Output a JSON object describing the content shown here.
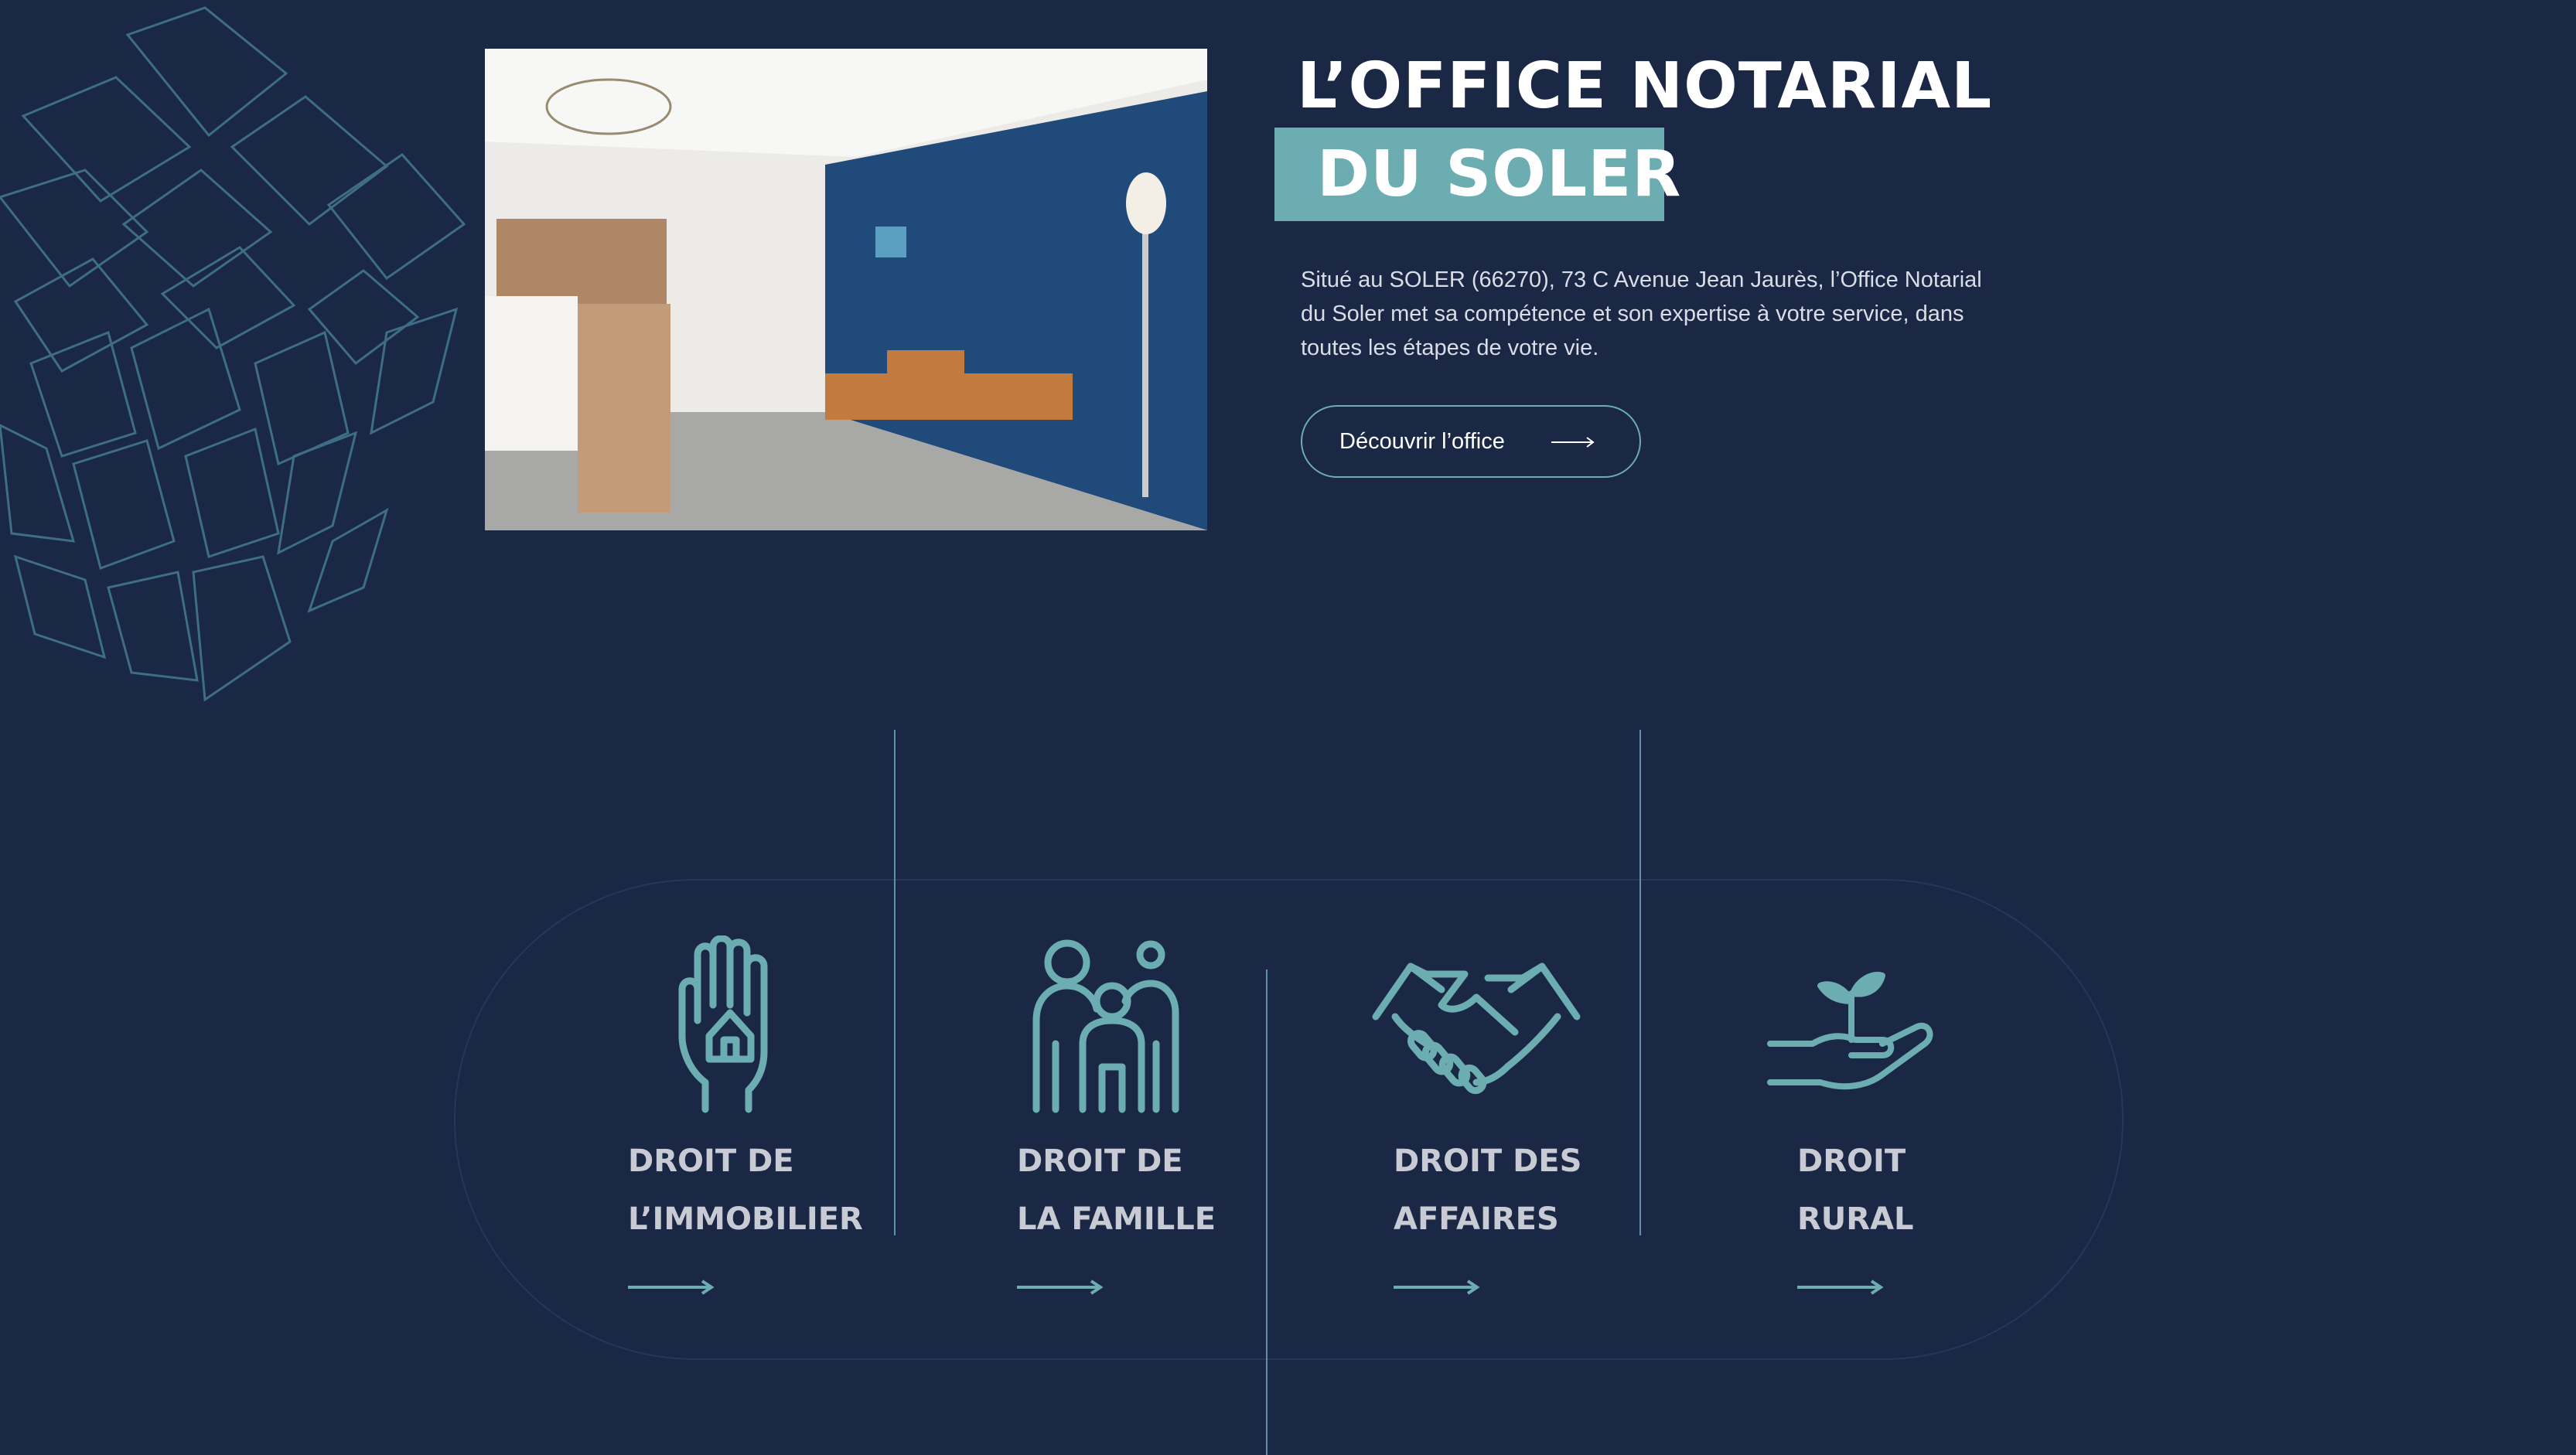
{
  "hero": {
    "title_line1": "L’OFFICE NOTARIAL",
    "title_line2": "DU SOLER",
    "intro": "Situé au SOLER (66270), 73 C Avenue Jean Jaurès, l’Office Notarial du Soler met sa compétence et son expertise à votre service, dans toutes les étapes de votre vie.",
    "cta_label": "Découvrir l’office"
  },
  "colors": {
    "background": "#1a2745",
    "accent": "#6cadb1",
    "text": "#ffffff",
    "muted_text": "#c8cbd4"
  },
  "services": [
    {
      "line1": "DROIT DE",
      "line2": "L’IMMOBILIER",
      "icon": "hand-house-icon"
    },
    {
      "line1": "DROIT DE",
      "line2": "LA FAMILLE",
      "icon": "family-icon"
    },
    {
      "line1": "DROIT DES",
      "line2": "AFFAIRES",
      "icon": "handshake-icon"
    },
    {
      "line1": "DROIT",
      "line2": "RURAL",
      "icon": "hand-sprout-icon"
    }
  ]
}
